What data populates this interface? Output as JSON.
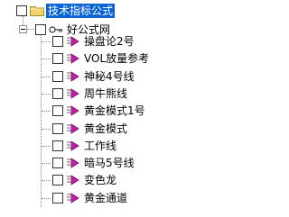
{
  "tree": {
    "root": {
      "label": "技术指标公式",
      "selected": true,
      "checked": false,
      "expanded": true,
      "icon": "folder-icon"
    },
    "group": {
      "label": "好公式网",
      "checked": false,
      "expanded": true,
      "icon": "key-icon"
    },
    "items": [
      {
        "label": "操盘论2号",
        "checked": false,
        "icon": "formula-icon"
      },
      {
        "label": "VOL放量参考",
        "checked": false,
        "icon": "formula-icon"
      },
      {
        "label": "神秘4号线",
        "checked": false,
        "icon": "formula-icon"
      },
      {
        "label": "周牛熊线",
        "checked": false,
        "icon": "formula-icon"
      },
      {
        "label": "黄金模式1号",
        "checked": false,
        "icon": "formula-icon"
      },
      {
        "label": "黄金模式",
        "checked": false,
        "icon": "formula-icon"
      },
      {
        "label": "工作线",
        "checked": false,
        "icon": "formula-icon"
      },
      {
        "label": "暗马5号线",
        "checked": false,
        "icon": "formula-icon"
      },
      {
        "label": "变色龙",
        "checked": false,
        "icon": "formula-icon"
      },
      {
        "label": "黄金通道",
        "checked": false,
        "icon": "formula-icon"
      }
    ]
  },
  "colors": {
    "selection": "#0a64d8",
    "formula_icon": "#c020a8",
    "folder": "#f2d36b"
  }
}
